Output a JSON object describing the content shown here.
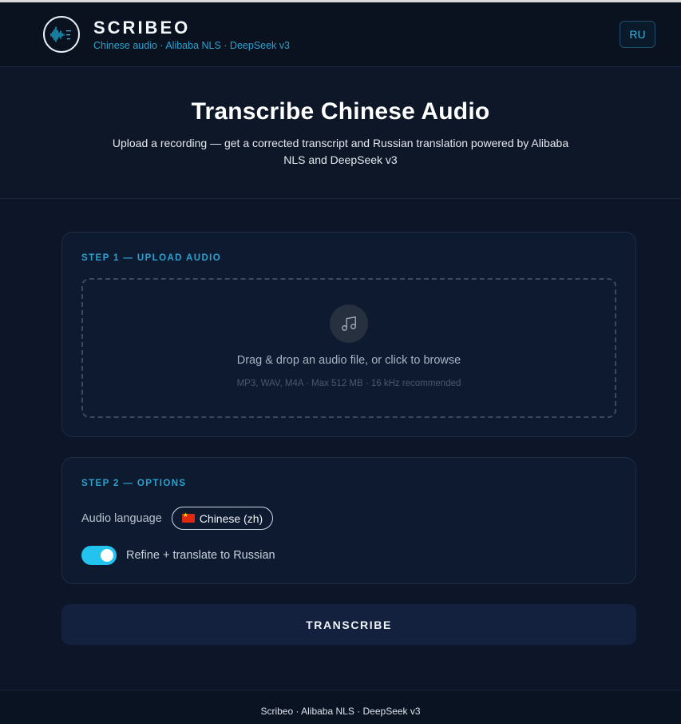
{
  "header": {
    "brand_title": "SCRIBEO",
    "brand_subtitle": "Chinese audio · Alibaba NLS · DeepSeek v3",
    "lang_button": "RU"
  },
  "hero": {
    "title": "Transcribe Chinese Audio",
    "subtitle": "Upload a recording — get a corrected transcript and Russian translation powered by Alibaba NLS and DeepSeek v3"
  },
  "upload": {
    "step_label": "STEP 1 — UPLOAD AUDIO",
    "drop_text": "Drag & drop an audio file, or click to browse",
    "drop_hint": "MP3, WAV, M4A · Max 512 MB · 16 kHz recommended",
    "icon": "music-note-icon"
  },
  "options": {
    "step_label": "STEP 2 — OPTIONS",
    "language_label": "Audio language",
    "language_value": "Chinese (zh)",
    "toggle_label": "Refine + translate to Russian",
    "toggle_on": true
  },
  "actions": {
    "transcribe_label": "TRANSCRIBE"
  },
  "footer": {
    "text": "Scribeo · Alibaba NLS · DeepSeek v3"
  },
  "colors": {
    "accent": "#22c3ee",
    "accent_text": "#2aa3cf",
    "background": "#0c1628",
    "card": "#0d1a30"
  }
}
